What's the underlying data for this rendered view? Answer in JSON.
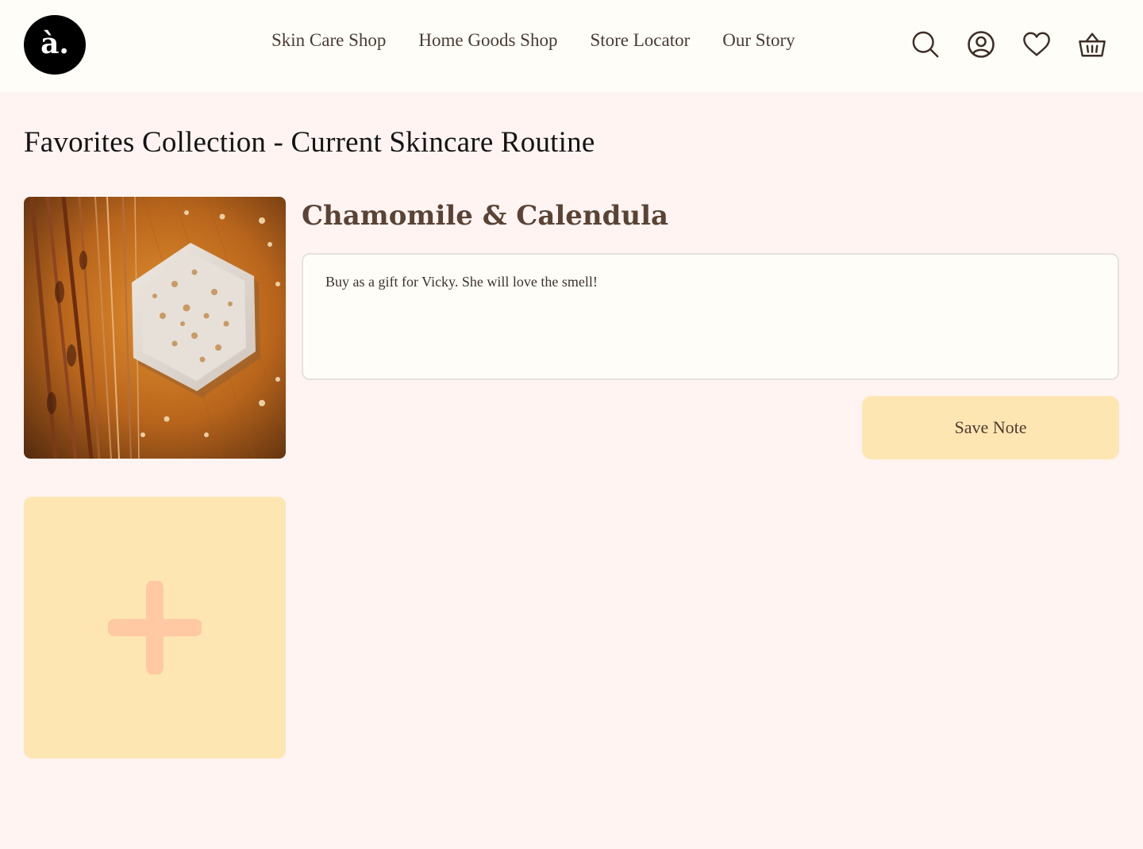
{
  "header": {
    "logo_text": "à.",
    "nav": [
      {
        "label": "Skin Care Shop"
      },
      {
        "label": "Home Goods Shop"
      },
      {
        "label": "Store Locator"
      },
      {
        "label": "Our Story"
      }
    ],
    "icons": [
      "search-icon",
      "account-icon",
      "heart-icon",
      "basket-icon"
    ]
  },
  "page": {
    "title": "Favorites Collection - Current Skincare Routine"
  },
  "favorite": {
    "name": "Chamomile & Calendula",
    "note_value": "Buy as a gift for Vicky. She will love the smell!",
    "save_label": "Save Note"
  },
  "colors": {
    "background": "#FFF4F2",
    "header_bg": "#FFFDF8",
    "accent_yellow": "#FEE6B2",
    "plus_peach": "#FFC9A3",
    "text_brown": "#5a4335"
  }
}
